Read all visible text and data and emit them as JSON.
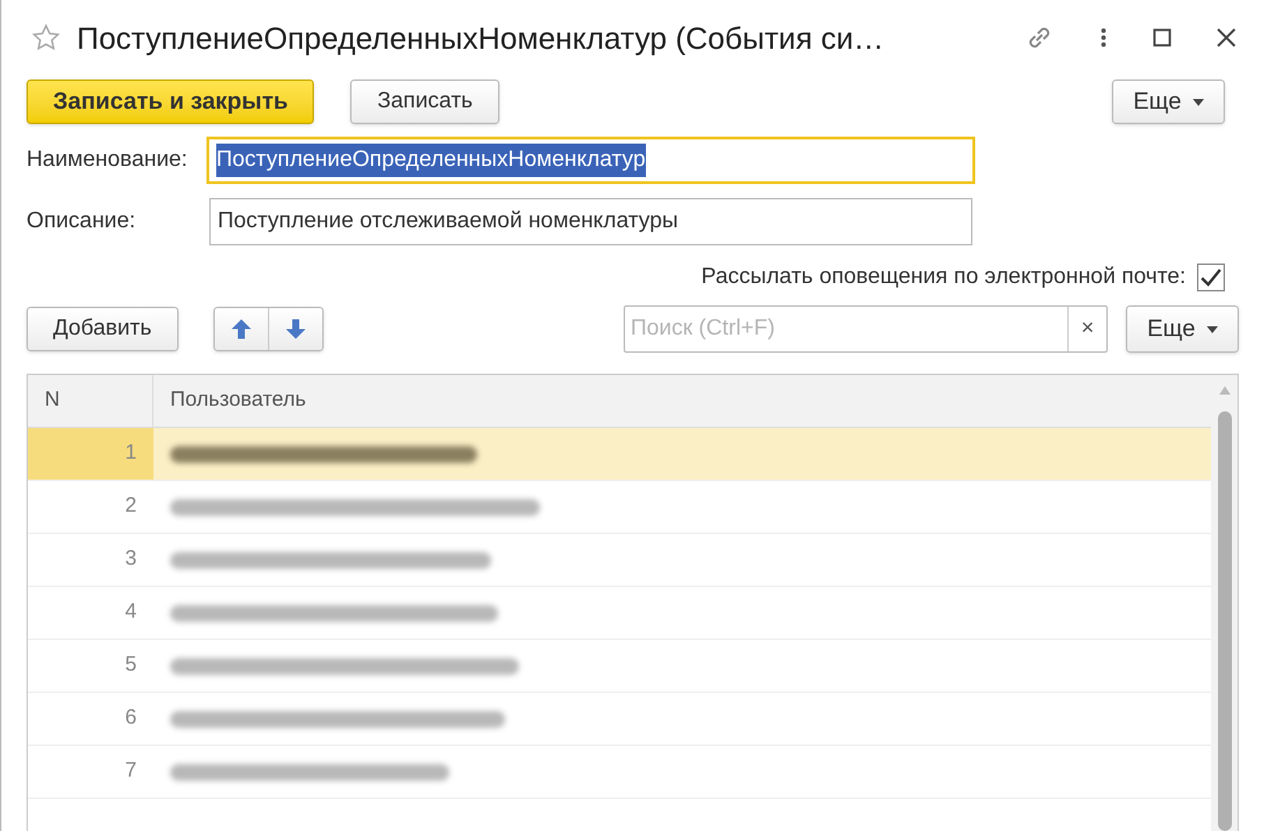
{
  "window": {
    "title": "ПоступлениеОпределенныхНоменклатур (События си…",
    "favorite": false
  },
  "command_bar": {
    "buttons": [
      {
        "label": "Записать и закрыть",
        "kind": "primary"
      },
      {
        "label": "Записать",
        "kind": "normal"
      }
    ],
    "more": "Еще"
  },
  "fields": [
    {
      "label": "Наименование:",
      "value": "ПоступлениеОпределенныхНоменклатур",
      "focused": true
    },
    {
      "label": "Описание:",
      "value": "Поступление отслеживаемой номенклатуры",
      "focused": false
    }
  ],
  "email_option": {
    "label": "Рассылать оповещения по электронной почте:",
    "checked": true
  },
  "table_bar": {
    "add": "Добавить",
    "search": {
      "placeholder": "Поиск (Ctrl+F)"
    },
    "clear": "×",
    "more": "Еще"
  },
  "table": {
    "columns": [
      "N",
      "Пользователь"
    ],
    "rows": [
      {
        "n": "1",
        "name_redacted": true,
        "selected": true
      },
      {
        "n": "2",
        "name_redacted": true,
        "selected": false
      },
      {
        "n": "3",
        "name_redacted": true,
        "selected": false
      },
      {
        "n": "4",
        "name_redacted": true,
        "selected": false
      },
      {
        "n": "5",
        "name_redacted": true,
        "selected": false
      },
      {
        "n": "6",
        "name_redacted": true,
        "selected": false
      },
      {
        "n": "7",
        "name_redacted": true,
        "selected": false
      }
    ]
  }
}
